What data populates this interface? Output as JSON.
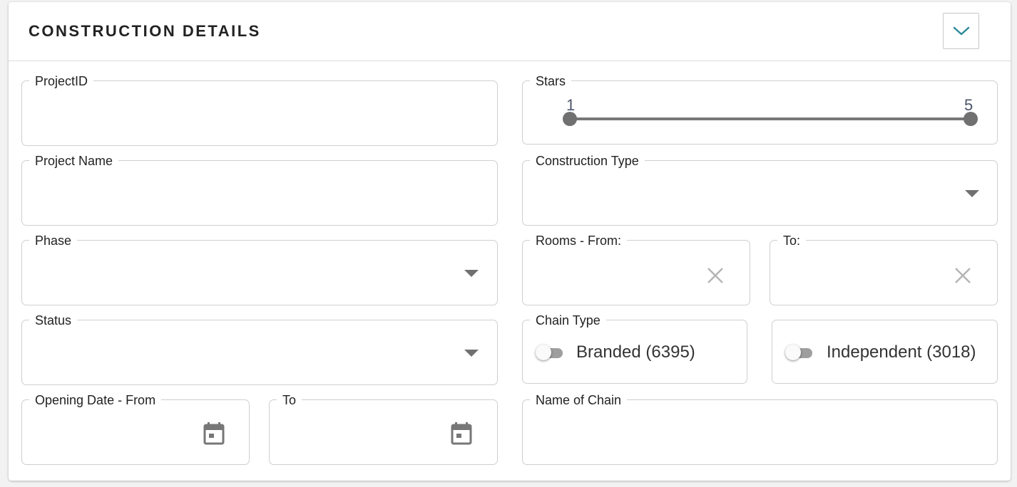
{
  "section": {
    "title": "CONSTRUCTION DETAILS",
    "collapse_icon": "chevron-down-icon",
    "accent_color": "#2e8b9a"
  },
  "fields": {
    "project_id": {
      "label": "ProjectID",
      "value": ""
    },
    "project_name": {
      "label": "Project Name",
      "value": ""
    },
    "phase": {
      "label": "Phase",
      "value": ""
    },
    "status": {
      "label": "Status",
      "value": ""
    },
    "opening_date_from": {
      "label": "Opening Date - From",
      "value": ""
    },
    "opening_date_to": {
      "label": "To",
      "value": ""
    },
    "stars": {
      "label": "Stars",
      "min_value": "1",
      "max_value": "5"
    },
    "construction_type": {
      "label": "Construction Type",
      "value": ""
    },
    "rooms_from": {
      "label": "Rooms - From:",
      "value": ""
    },
    "rooms_to": {
      "label": "To:",
      "value": ""
    },
    "chain_type": {
      "label": "Chain Type",
      "branded": {
        "label": "Branded (6395)",
        "checked": false
      },
      "independent": {
        "label": "Independent (3018)",
        "checked": false
      }
    },
    "name_of_chain": {
      "label": "Name of Chain",
      "value": ""
    }
  }
}
